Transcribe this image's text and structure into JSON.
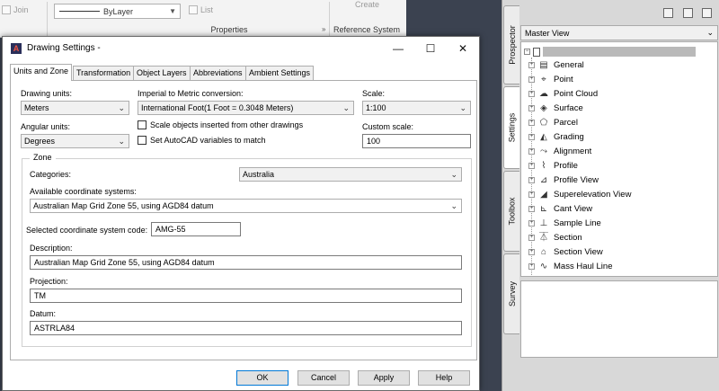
{
  "ribbon": {
    "join_label": "Join",
    "linetype_value": "ByLayer",
    "list_label": "List",
    "create_label": "Create",
    "properties_label": "Properties",
    "reference_system_label": "Reference System"
  },
  "palette": {
    "tabs": [
      "Prospector",
      "Settings",
      "Toolbox",
      "Survey"
    ],
    "active_tab": "Settings",
    "view_value": "Master View",
    "tree_items": [
      {
        "label": "General",
        "icon": "general-icon"
      },
      {
        "label": "Point",
        "icon": "point-icon"
      },
      {
        "label": "Point Cloud",
        "icon": "point-cloud-icon"
      },
      {
        "label": "Surface",
        "icon": "surface-icon"
      },
      {
        "label": "Parcel",
        "icon": "parcel-icon"
      },
      {
        "label": "Grading",
        "icon": "grading-icon"
      },
      {
        "label": "Alignment",
        "icon": "alignment-icon"
      },
      {
        "label": "Profile",
        "icon": "profile-icon"
      },
      {
        "label": "Profile View",
        "icon": "profile-view-icon"
      },
      {
        "label": "Superelevation View",
        "icon": "superelevation-view-icon"
      },
      {
        "label": "Cant View",
        "icon": "cant-view-icon"
      },
      {
        "label": "Sample Line",
        "icon": "sample-line-icon"
      },
      {
        "label": "Section",
        "icon": "section-icon"
      },
      {
        "label": "Section View",
        "icon": "section-view-icon"
      },
      {
        "label": "Mass Haul Line",
        "icon": "mass-haul-line-icon"
      }
    ]
  },
  "dialog": {
    "title": "Drawing Settings -",
    "tabs": [
      "Units and Zone",
      "Transformation",
      "Object Layers",
      "Abbreviations",
      "Ambient Settings"
    ],
    "active_tab": "Units and Zone",
    "drawing_units_label": "Drawing units:",
    "drawing_units_value": "Meters",
    "imperial_label": "Imperial to Metric conversion:",
    "imperial_value": "International Foot(1 Foot = 0.3048 Meters)",
    "scale_label": "Scale:",
    "scale_value": "1:100",
    "angular_units_label": "Angular units:",
    "angular_units_value": "Degrees",
    "scale_objects_label": "Scale objects inserted from other drawings",
    "set_autocad_label": "Set AutoCAD variables to match",
    "custom_scale_label": "Custom scale:",
    "custom_scale_value": "100",
    "zone_label": "Zone",
    "categories_label": "Categories:",
    "categories_value": "Australia",
    "available_cs_label": "Available coordinate systems:",
    "available_cs_value": "Australian Map Grid Zone 55, using AGD84 datum",
    "selected_code_label": "Selected coordinate system code:",
    "selected_code_value": "AMG-55",
    "description_label": "Description:",
    "description_value": "Australian Map Grid Zone 55, using AGD84 datum",
    "projection_label": "Projection:",
    "projection_value": "TM",
    "datum_label": "Datum:",
    "datum_value": "ASTRLA84",
    "buttons": {
      "ok": "OK",
      "cancel": "Cancel",
      "apply": "Apply",
      "help": "Help"
    }
  }
}
